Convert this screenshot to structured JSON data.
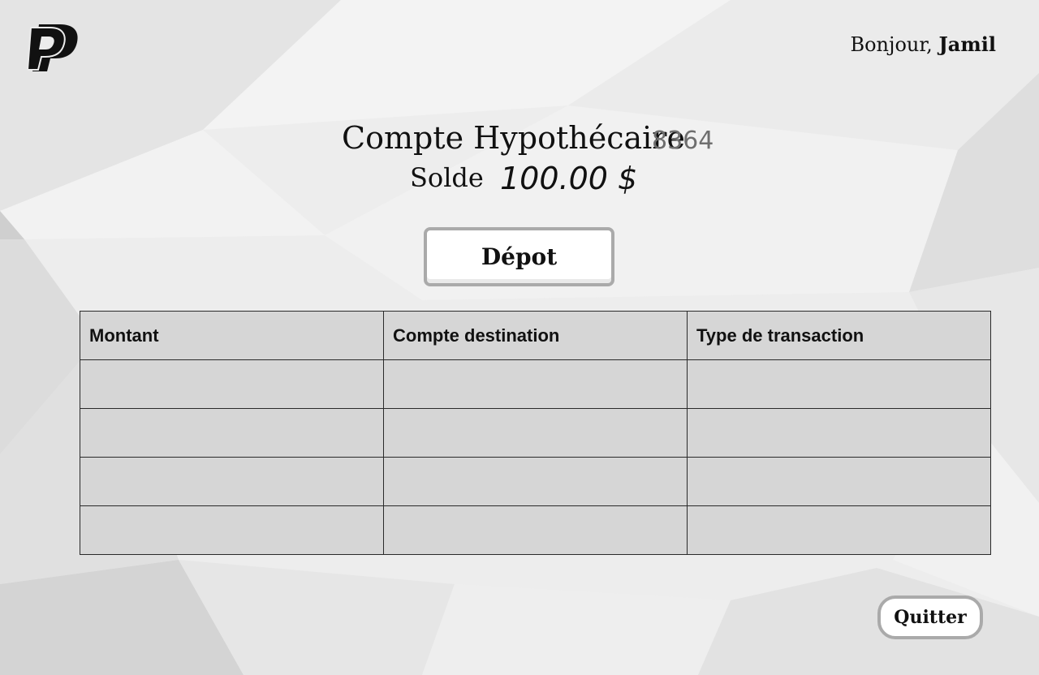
{
  "header": {
    "greeting_prefix": "Bonjour,",
    "user_name": "Jamil",
    "logo_icon": "paypal-logo-icon"
  },
  "account": {
    "title": "Compte Hypothécaire",
    "number": "8364",
    "balance_label": "Solde",
    "balance_value": "100.00 $"
  },
  "actions": {
    "deposit_label": "Dépot",
    "quit_label": "Quitter"
  },
  "table": {
    "columns": [
      "Montant",
      "Compte destination",
      "Type de transaction"
    ],
    "rows": [
      [
        "",
        "",
        ""
      ],
      [
        "",
        "",
        ""
      ],
      [
        "",
        "",
        ""
      ],
      [
        "",
        "",
        ""
      ]
    ]
  },
  "colors": {
    "background": "#ececec",
    "table_fill": "#d6d6d6",
    "button_border": "#aaaaaa",
    "text": "#111111",
    "muted_text": "#6e6e6e"
  }
}
